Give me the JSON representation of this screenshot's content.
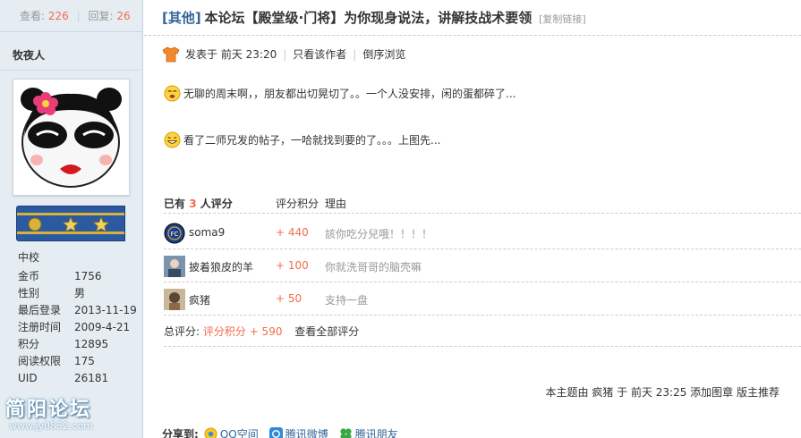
{
  "sidebar": {
    "views_label": "查看:",
    "views": "226",
    "replies_label": "回复:",
    "replies": "26",
    "username": "牧夜人",
    "rank_title": "中校",
    "info": [
      {
        "k": "金币",
        "v": "1756"
      },
      {
        "k": "性别",
        "v": "男"
      },
      {
        "k": "最后登录",
        "v": "2013-11-19"
      },
      {
        "k": "注册时间",
        "v": "2009-4-21"
      },
      {
        "k": "积分",
        "v": "12895"
      },
      {
        "k": "阅读权限",
        "v": "175"
      },
      {
        "k": "UID",
        "v": "26181"
      }
    ],
    "watermark_title": "简阳论坛",
    "watermark_url": "www.jy0832.com"
  },
  "thread": {
    "category": "[其他]",
    "title": "本论坛【殿堂级·门将】为你现身说法，讲解技战术要领",
    "copy_link": "[复制链接]"
  },
  "meta": {
    "posted": "发表于 前天 23:20",
    "only_author": "只看该作者",
    "reverse": "倒序浏览"
  },
  "post": {
    "line1": "无聊的周末啊，，朋友都出切晃切了。。一个人没安排，闲的蛋都碎了...",
    "line2": "看了二师兄发的帖子，一哈就找到要的了。。。上图先..."
  },
  "rating": {
    "head_prefix": "已有",
    "head_count": "3",
    "head_suffix": "人评分",
    "col_score": "评分积分",
    "col_reason": "理由",
    "rows": [
      {
        "name": "soma9",
        "score": "+ 440",
        "reason": "該你吃分兒哦！！！！"
      },
      {
        "name": "披着狼皮的羊",
        "score": "+ 100",
        "reason": "你就洗哥哥的脑壳嘛"
      },
      {
        "name": "疯猪",
        "score": "+ 50",
        "reason": "支持一盘"
      }
    ],
    "total_label": "总评分:",
    "total_value": "评分积分 + 590",
    "view_all": "查看全部评分"
  },
  "recommend": "本主题由 疯猪 于 前天 23:25 添加图章 版主推荐",
  "share": {
    "label": "分享到:",
    "items": [
      "QQ空间",
      "腾讯微博",
      "腾讯朋友"
    ]
  },
  "colors": {
    "accent": "#f26c4f",
    "link": "#336699",
    "sidebar_bg": "#e5edf2"
  }
}
